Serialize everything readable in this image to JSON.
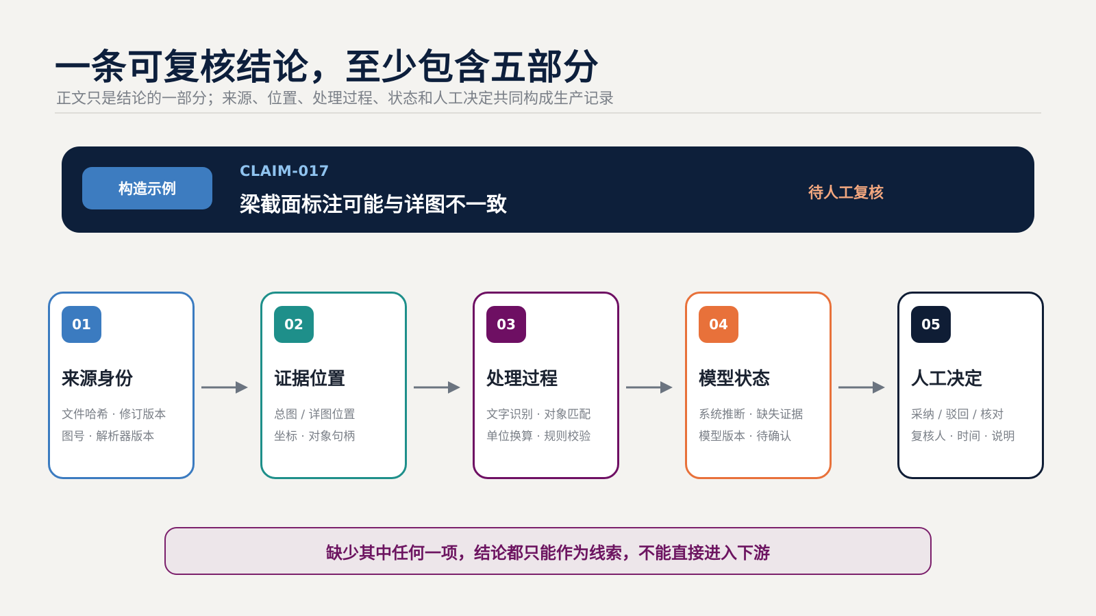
{
  "header": {
    "title": "一条可复核结论，至少包含五部分",
    "subtitle": "正文只是结论的一部分；来源、位置、处理过程、状态和人工决定共同构成生产记录"
  },
  "claim": {
    "badge": "构造示例",
    "id": "CLAIM-017",
    "title": "梁截面标注可能与详图不一致",
    "status": "待人工复核"
  },
  "steps": [
    {
      "num": "01",
      "title": "来源身份",
      "line1": "文件哈希 · 修订版本",
      "line2": "图号 · 解析器版本",
      "color": "#3b7bc0"
    },
    {
      "num": "02",
      "title": "证据位置",
      "line1": "总图 / 详图位置",
      "line2": "坐标 · 对象句柄",
      "color": "#1e8f8a"
    },
    {
      "num": "03",
      "title": "处理过程",
      "line1": "文字识别 · 对象匹配",
      "line2": "单位换算 · 规则校验",
      "color": "#6e0f63"
    },
    {
      "num": "04",
      "title": "模型状态",
      "line1": "系统推断 · 缺失证据",
      "line2": "模型版本 · 待确认",
      "color": "#e8713a"
    },
    {
      "num": "05",
      "title": "人工决定",
      "line1": "采纳 / 驳回 / 核对",
      "line2": "复核人 · 时间 · 说明",
      "color": "#0f1d35"
    }
  ],
  "note": "缺少其中任何一项，结论都只能作为线索，不能直接进入下游",
  "colors": {
    "arrow": "#6b7480",
    "banner": "#0d1f3a",
    "note_border": "#7b1f6b"
  }
}
